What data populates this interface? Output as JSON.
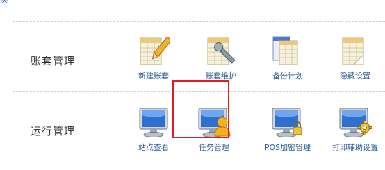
{
  "header": {
    "tab_label": "类"
  },
  "sections": [
    {
      "title": "账套管理",
      "items": [
        {
          "label": "新建账套",
          "icon": "new-ledger-pencil-icon"
        },
        {
          "label": "账套维护",
          "icon": "ledger-wrench-icon"
        },
        {
          "label": "备份计划",
          "icon": "backup-plan-icon"
        },
        {
          "label": "隐藏设置",
          "icon": "hide-settings-icon"
        }
      ]
    },
    {
      "title": "运行管理",
      "items": [
        {
          "label": "站点查看",
          "icon": "monitor-icon"
        },
        {
          "label": "任务管理",
          "icon": "monitor-user-icon",
          "highlighted": true
        },
        {
          "label": "POS加密管理",
          "icon": "monitor-lock-icon"
        },
        {
          "label": "打印辅助设置",
          "icon": "monitor-gear-icon"
        }
      ]
    }
  ],
  "colors": {
    "label": "#2d5f95",
    "highlight": "#e02020",
    "monitor_screen": "#2f6fd0"
  }
}
